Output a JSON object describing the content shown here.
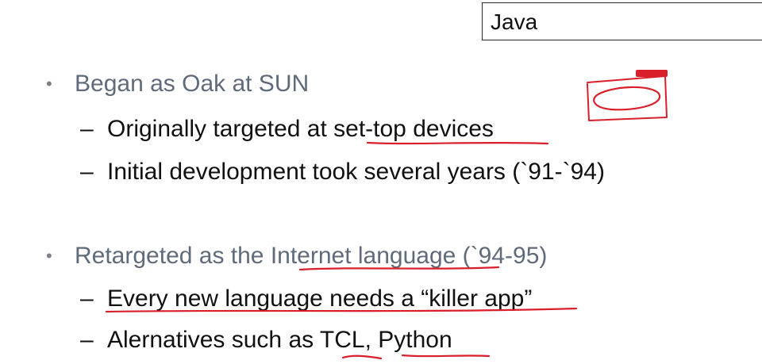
{
  "slide": {
    "title": "Java",
    "bullets": [
      {
        "text": "Began as Oak at SUN",
        "subitems": [
          "Originally targeted at set-top devices",
          "Initial development took several years (`91-`94)"
        ]
      },
      {
        "text": "Retargeted as the Internet language (`94-95)",
        "subitems": [
          "Every new language needs a “killer app”",
          "Alernatives such as TCL, Python"
        ]
      }
    ],
    "bullet_marker": "•",
    "dash_marker": "–"
  },
  "colors": {
    "bullet_text": "#5f6b7a",
    "sub_text": "#111111",
    "annotation": "#d81f2a",
    "title_border": "#2a2a2a"
  }
}
